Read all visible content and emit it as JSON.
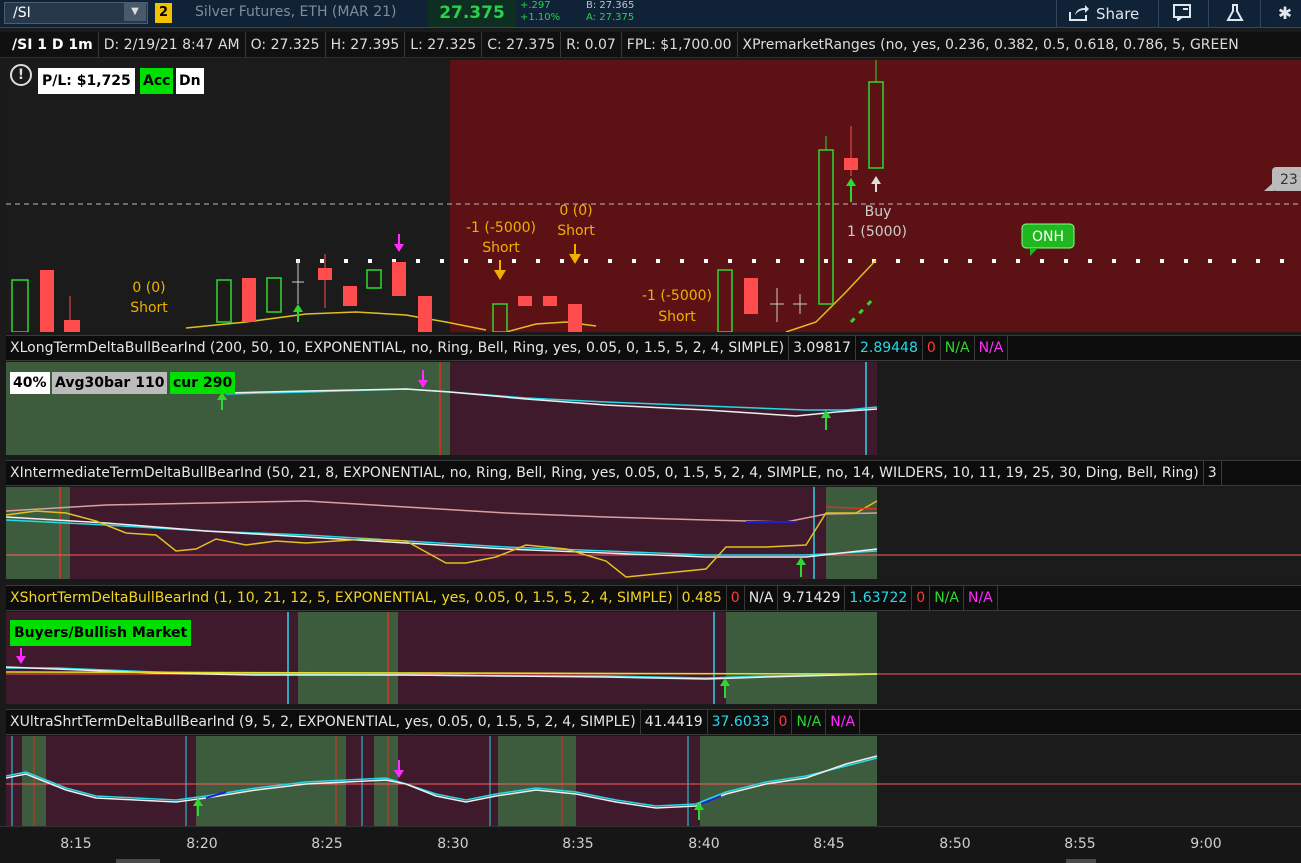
{
  "topbar": {
    "symbol": "/SI",
    "link_number": "2",
    "description": "Silver Futures, ETH (MAR 21)",
    "last": "27.375",
    "change_abs": "+.297",
    "change_pct": "+1.10%",
    "bid": "B: 27.365",
    "ask": "A: 27.375",
    "share_label": "Share",
    "icons": [
      "share-icon",
      "messages-icon",
      "flask-icon",
      "gear-icon"
    ]
  },
  "infobar": {
    "title": "/SI 1 D 1m",
    "date": "D: 2/19/21 8:47 AM",
    "open": "O: 27.325",
    "high": "H: 27.395",
    "low": "L: 27.325",
    "close": "C: 27.375",
    "range": "R: 0.07",
    "fpl": "FPL: $1,700.00",
    "study": "XPremarketRanges (no, yes, 0.236, 0.382, 0.5, 0.618, 0.786, 5, GREEN"
  },
  "price_pane": {
    "pl_label": "P/L: $1,725",
    "acc_label": "Acc",
    "dn_label": "Dn",
    "right_tag": "23",
    "onh_label": "ONH",
    "orders": [
      {
        "qty": "0 (0)",
        "side": "Short"
      },
      {
        "qty": "-1 (-5000)",
        "side": "Short"
      },
      {
        "qty": "0 (0)",
        "side": "Short"
      },
      {
        "qty": "-1 (-5000)",
        "side": "Short"
      },
      {
        "qty": "1 (5000)",
        "side": "Buy"
      }
    ]
  },
  "study1": {
    "name": "XLongTermDeltaBullBearInd (200, 50, 10, EXPONENTIAL, no, Ring, Bell, Ring, yes, 0.05, 0, 1.5, 5, 2, 4, SIMPLE)",
    "v1": "3.09817",
    "v2": "2.89448",
    "v3": "0",
    "v4": "N/A",
    "v5": "N/A",
    "pct": "40%",
    "avg": "Avg30bar 110",
    "cur": "cur 290"
  },
  "study2": {
    "name": "XIntermediateTermDeltaBullBearInd (50, 21, 8, EXPONENTIAL, no, Ring, Bell, Ring, yes, 0.05, 0, 1.5, 5, 2, 4, SIMPLE, no, 14, WILDERS, 10, 11, 19, 25, 30, Ding, Bell, Ring)",
    "v1": "3"
  },
  "study3": {
    "name": "XShortTermDeltaBullBearInd (1, 10, 21, 12, 5, EXPONENTIAL, yes, 0.05, 0, 1.5, 5, 2, 4, SIMPLE)",
    "v1": "0.485",
    "v2": "0",
    "v3": "N/A",
    "v4": "9.71429",
    "v5": "1.63722",
    "v6": "0",
    "v7": "N/A",
    "v8": "N/A",
    "label": "Buyers/Bullish Market"
  },
  "study4": {
    "name": "XUltraShrtTermDeltaBullBearInd (9, 5, 2, EXPONENTIAL, yes, 0.05, 0, 1.5, 5, 2, 4, SIMPLE)",
    "v1": "41.4419",
    "v2": "37.6033",
    "v3": "0",
    "v4": "N/A",
    "v5": "N/A"
  },
  "time_axis": [
    "8:15",
    "8:20",
    "8:25",
    "8:30",
    "8:35",
    "8:40",
    "8:45",
    "8:50",
    "8:55",
    "9:00"
  ],
  "colors": {
    "bear_bg": "#5c1215",
    "pane_bg_dark": "#1b1b1b",
    "green_zone": "#3d5c3d",
    "maroon_zone": "#3f1a2c",
    "up_candle": "#2fd82f",
    "down_candle": "#ff4d4d",
    "last_price": "#29d04a"
  }
}
